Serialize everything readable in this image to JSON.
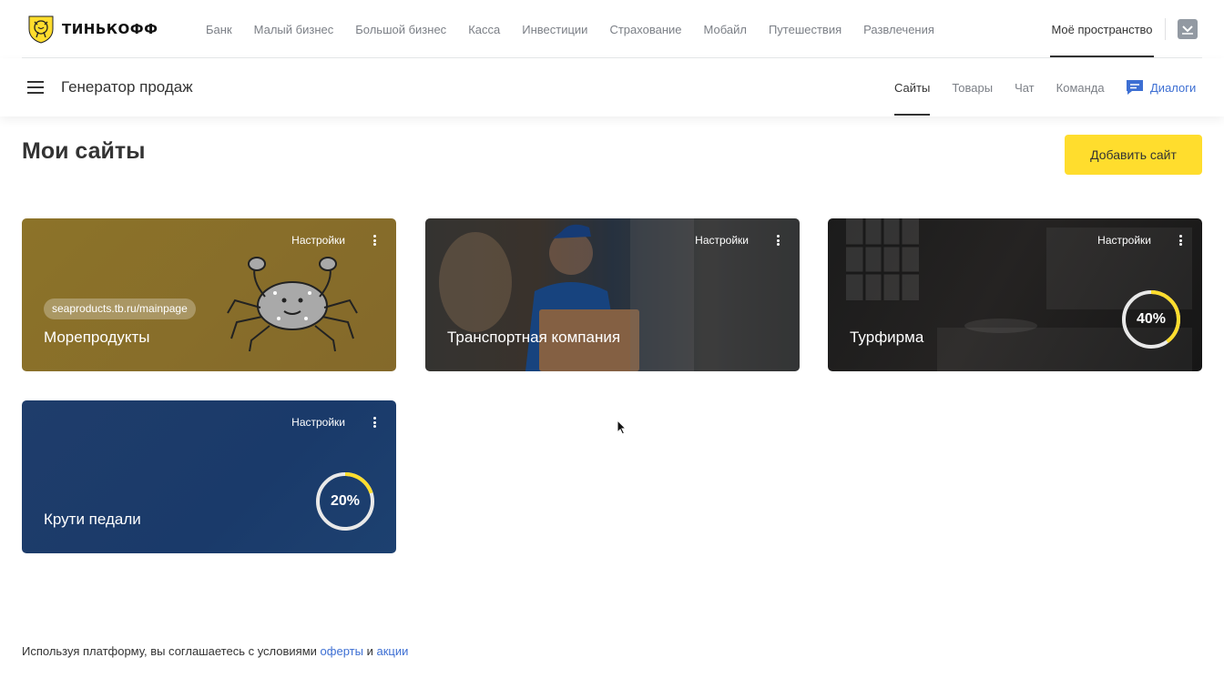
{
  "brand": {
    "name": "ТИНЬКОФФ"
  },
  "topnav": {
    "items": [
      "Банк",
      "Малый бизнес",
      "Большой бизнес",
      "Касса",
      "Инвестиции",
      "Страхование",
      "Мобайл",
      "Путешествия",
      "Развлечения"
    ],
    "myspace": "Моё пространство"
  },
  "subbar": {
    "title": "Генератор продаж",
    "tabs": [
      "Сайты",
      "Товары",
      "Чат",
      "Команда"
    ],
    "active_tab": "Сайты",
    "dialogs": "Диалоги"
  },
  "page": {
    "title": "Мои сайты",
    "add_button": "Добавить сайт"
  },
  "cards": [
    {
      "name": "Морепродукты",
      "url": "seaproducts.tb.ru/mainpage",
      "settings": "Настройки"
    },
    {
      "name": "Транспортная компания",
      "settings": "Настройки"
    },
    {
      "name": "Турфирма",
      "settings": "Настройки",
      "progress_label": "40%",
      "progress": 0.4
    },
    {
      "name": "Крути педали",
      "settings": "Настройки",
      "progress_label": "20%",
      "progress": 0.2
    }
  ],
  "footer": {
    "text": "Используя платформу, вы соглашаетесь с условиями",
    "link_offer": "оферты",
    "and": "и",
    "link_promo": "акции"
  },
  "colors": {
    "accent_yellow": "#ffdd2d",
    "link_blue": "#3d6fd3",
    "progress_yellow": "#ffdd2d"
  },
  "icons": [
    "tinkoff-logo-icon",
    "tray-icon",
    "burger-menu-icon",
    "chat-bubble-icon",
    "kebab-menu-icon",
    "crab-illustration",
    "mouse-cursor-icon"
  ]
}
